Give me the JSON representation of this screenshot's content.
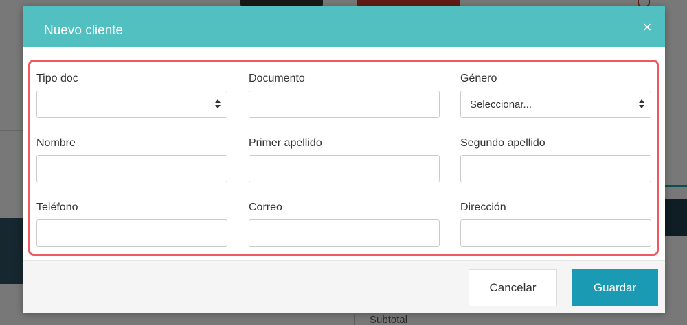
{
  "background": {
    "subtotal_label": "Subtotal"
  },
  "modal": {
    "title": "Nuevo cliente",
    "close_glyph": "×",
    "fields": {
      "tipo_doc": {
        "label": "Tipo doc",
        "value": ""
      },
      "documento": {
        "label": "Documento",
        "value": ""
      },
      "genero": {
        "label": "Género",
        "value": "Seleccionar..."
      },
      "nombre": {
        "label": "Nombre",
        "value": ""
      },
      "primer_apellido": {
        "label": "Primer apellido",
        "value": ""
      },
      "segundo_apellido": {
        "label": "Segundo apellido",
        "value": ""
      },
      "telefono": {
        "label": "Teléfono",
        "value": ""
      },
      "correo": {
        "label": "Correo",
        "value": ""
      },
      "direccion": {
        "label": "Dirección",
        "value": ""
      }
    },
    "footer": {
      "cancel_label": "Cancelar",
      "save_label": "Guardar"
    }
  },
  "colors": {
    "header": "#52bfc0",
    "primary": "#1b9ab3",
    "highlight_border": "#ef5a62"
  }
}
